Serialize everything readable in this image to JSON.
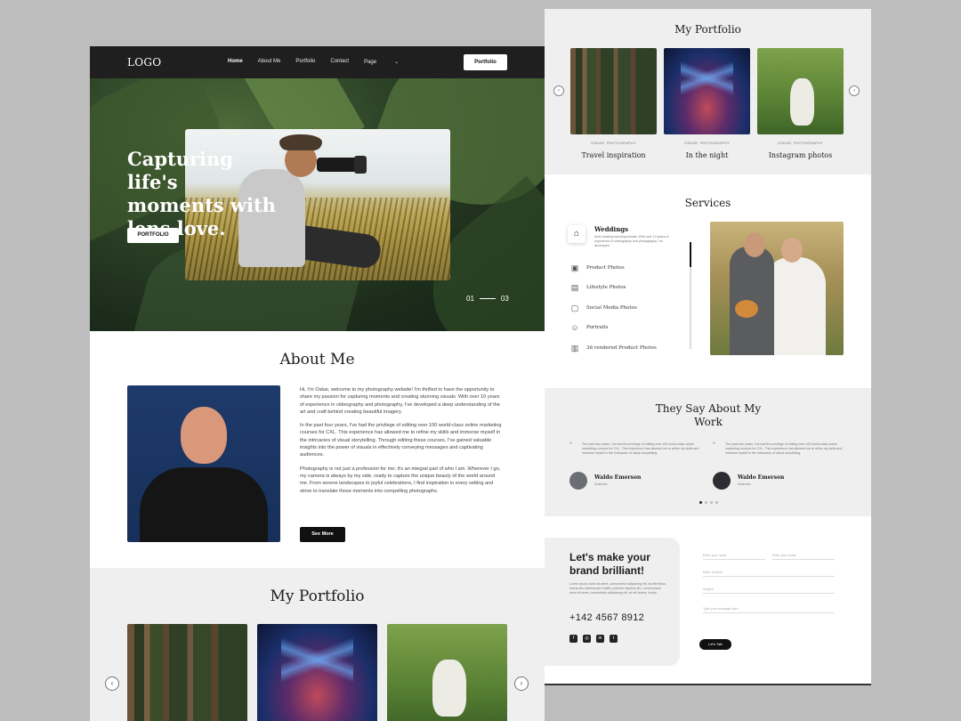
{
  "nav": {
    "logo": "LOGO",
    "items": [
      "Home",
      "About Me",
      "Portfolio",
      "Contact",
      "Page"
    ],
    "cta": "Portfolio"
  },
  "hero": {
    "title": "Capturing life's moments with lens love.",
    "button": "PORTFOLIO",
    "slide_current": "01",
    "slide_total": "03"
  },
  "about": {
    "title": "About Me",
    "paragraphs": [
      "Hi, I'm Oskar, welcome to my photography website! I'm thrilled to have the opportunity to share my passion for capturing moments and creating stunning visuals. With over 10 years of experience in videography and photography, I've developed a deep understanding of the art and craft behind creating beautiful imagery.",
      "In the past four years, I've had the privilege of editing over 100 world-class online marketing courses for CXL. This experience has allowed me to refine my skills and immerse myself in the intricacies of visual storytelling. Through editing these courses, I've gained valuable insights into the power of visuals in effectively conveying messages and captivating audiences.",
      "Photography is not just a profession for me; it's an integral part of who I am. Wherever I go, my camera is always by my side, ready to capture the unique beauty of the world around me. From serene landscapes to joyful celebrations, I find inspiration in every setting and strive to translate those moments into compelling photographs."
    ],
    "button": "See More"
  },
  "portfolio": {
    "title": "My Portfolio",
    "items": [
      {
        "meta": "OSKAR, PHOTOGRAPHY",
        "caption": "Travel inspiration"
      },
      {
        "meta": "OSKAR, PHOTOGRAPHY",
        "caption": "In the night"
      },
      {
        "meta": "OSKAR, PHOTOGRAPHY",
        "caption": "Instagram photos"
      }
    ],
    "prev": "‹",
    "next": "›"
  },
  "services": {
    "title": "Services",
    "active": {
      "label": "Weddings",
      "desc": "Andi creating stunning visuals. With over 10 years of experience in videography and photography, I've developed"
    },
    "items": [
      "Product Photos",
      "Lifestyle Photos",
      "Social Media Photos",
      "Portraits",
      "3d rendered Product Photos"
    ]
  },
  "testimonials": {
    "title": "They Say About My Work",
    "quotes": [
      {
        "text": "The past four years, I've had the privilege of editing over 100 world-class online marketing courses for CXL. This experience has allowed me to refine my skills and immerse myself in the intricacies of visual storytelling.",
        "name": "Waldo Emerson",
        "role": "Illustrator"
      },
      {
        "text": "The past four years, I've had the privilege of editing over 100 world-class online marketing courses for CXL. This experience has allowed me to refine my skills and immerse myself in the intricacies of visual storytelling.",
        "name": "Waldo Emerson",
        "role": "Illustrator"
      }
    ]
  },
  "contact": {
    "title": "Let's make your brand brilliant!",
    "sub": "Lorem ipsum dolor sit amet, consectetur adipiscing elit, sit elit lectus, luctus nec ullamcorper mattis, pulvinar dapibus leo. Lorem ipsum dolor sit amet, consectetur adipiscing elit, sit elit lectus, luctus.",
    "phone": "+142 4567 8912",
    "fields": [
      "Enter your name",
      "Enter your email",
      "Enter Subject",
      "Subject",
      "Type your message here"
    ],
    "button": "Let's Talk",
    "social_icons": [
      "facebook-icon",
      "instagram-icon",
      "linkedin-icon",
      "twitter-icon"
    ]
  }
}
